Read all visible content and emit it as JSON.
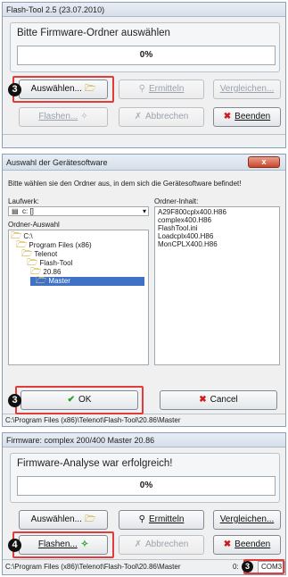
{
  "win1": {
    "title": "Flash-Tool 2.5 (23.07.2010)",
    "heading": "Bitte Firmware-Ordner auswählen",
    "progress": "0%",
    "buttons": {
      "auswaehlen": "Auswählen...",
      "ermitteln": "Ermitteln",
      "vergleichen": "Vergleichen...",
      "flashen": "Flashen...",
      "abbrechen": "Abbrechen",
      "beenden": "Beenden"
    },
    "step": "3"
  },
  "win2": {
    "title": "Auswahl der Gerätesoftware",
    "close": "x",
    "instruction": "Bitte wählen sie den Ordner aus, in dem sich die Gerätesoftware befindet!",
    "drive_label": "Laufwerk:",
    "drive_value": "c: []",
    "folder_label": "Ordner-Auswahl",
    "content_label": "Ordner-Inhalt:",
    "tree": [
      "C:\\",
      "Program Files (x86)",
      "Telenot",
      "Flash-Tool",
      "20.86",
      "Master"
    ],
    "files": [
      "A29F800cplx400.H86",
      "complex400.H86",
      "FlashTool.ini",
      "Loadcplx400.H86",
      "MonCPLX400.H86"
    ],
    "ok": "OK",
    "cancel": "Cancel",
    "status": "C:\\Program Files (x86)\\Telenot\\Flash-Tool\\20.86\\Master",
    "step": "3"
  },
  "win3": {
    "title": "Firmware: complex 200/400  Master  20.86",
    "heading": "Firmware-Analyse war erfolgreich!",
    "progress": "0%",
    "buttons": {
      "auswaehlen": "Auswählen...",
      "ermitteln": "Ermitteln",
      "vergleichen": "Vergleichen...",
      "flashen": "Flashen...",
      "abbrechen": "Abbrechen",
      "beenden": "Beenden"
    },
    "status_path": "C:\\Program Files (x86)\\Telenot\\Flash-Tool\\20.86\\Master",
    "status_port_prefix": "0:",
    "com": "COM3",
    "step_flash": "4",
    "step_com": "3"
  }
}
